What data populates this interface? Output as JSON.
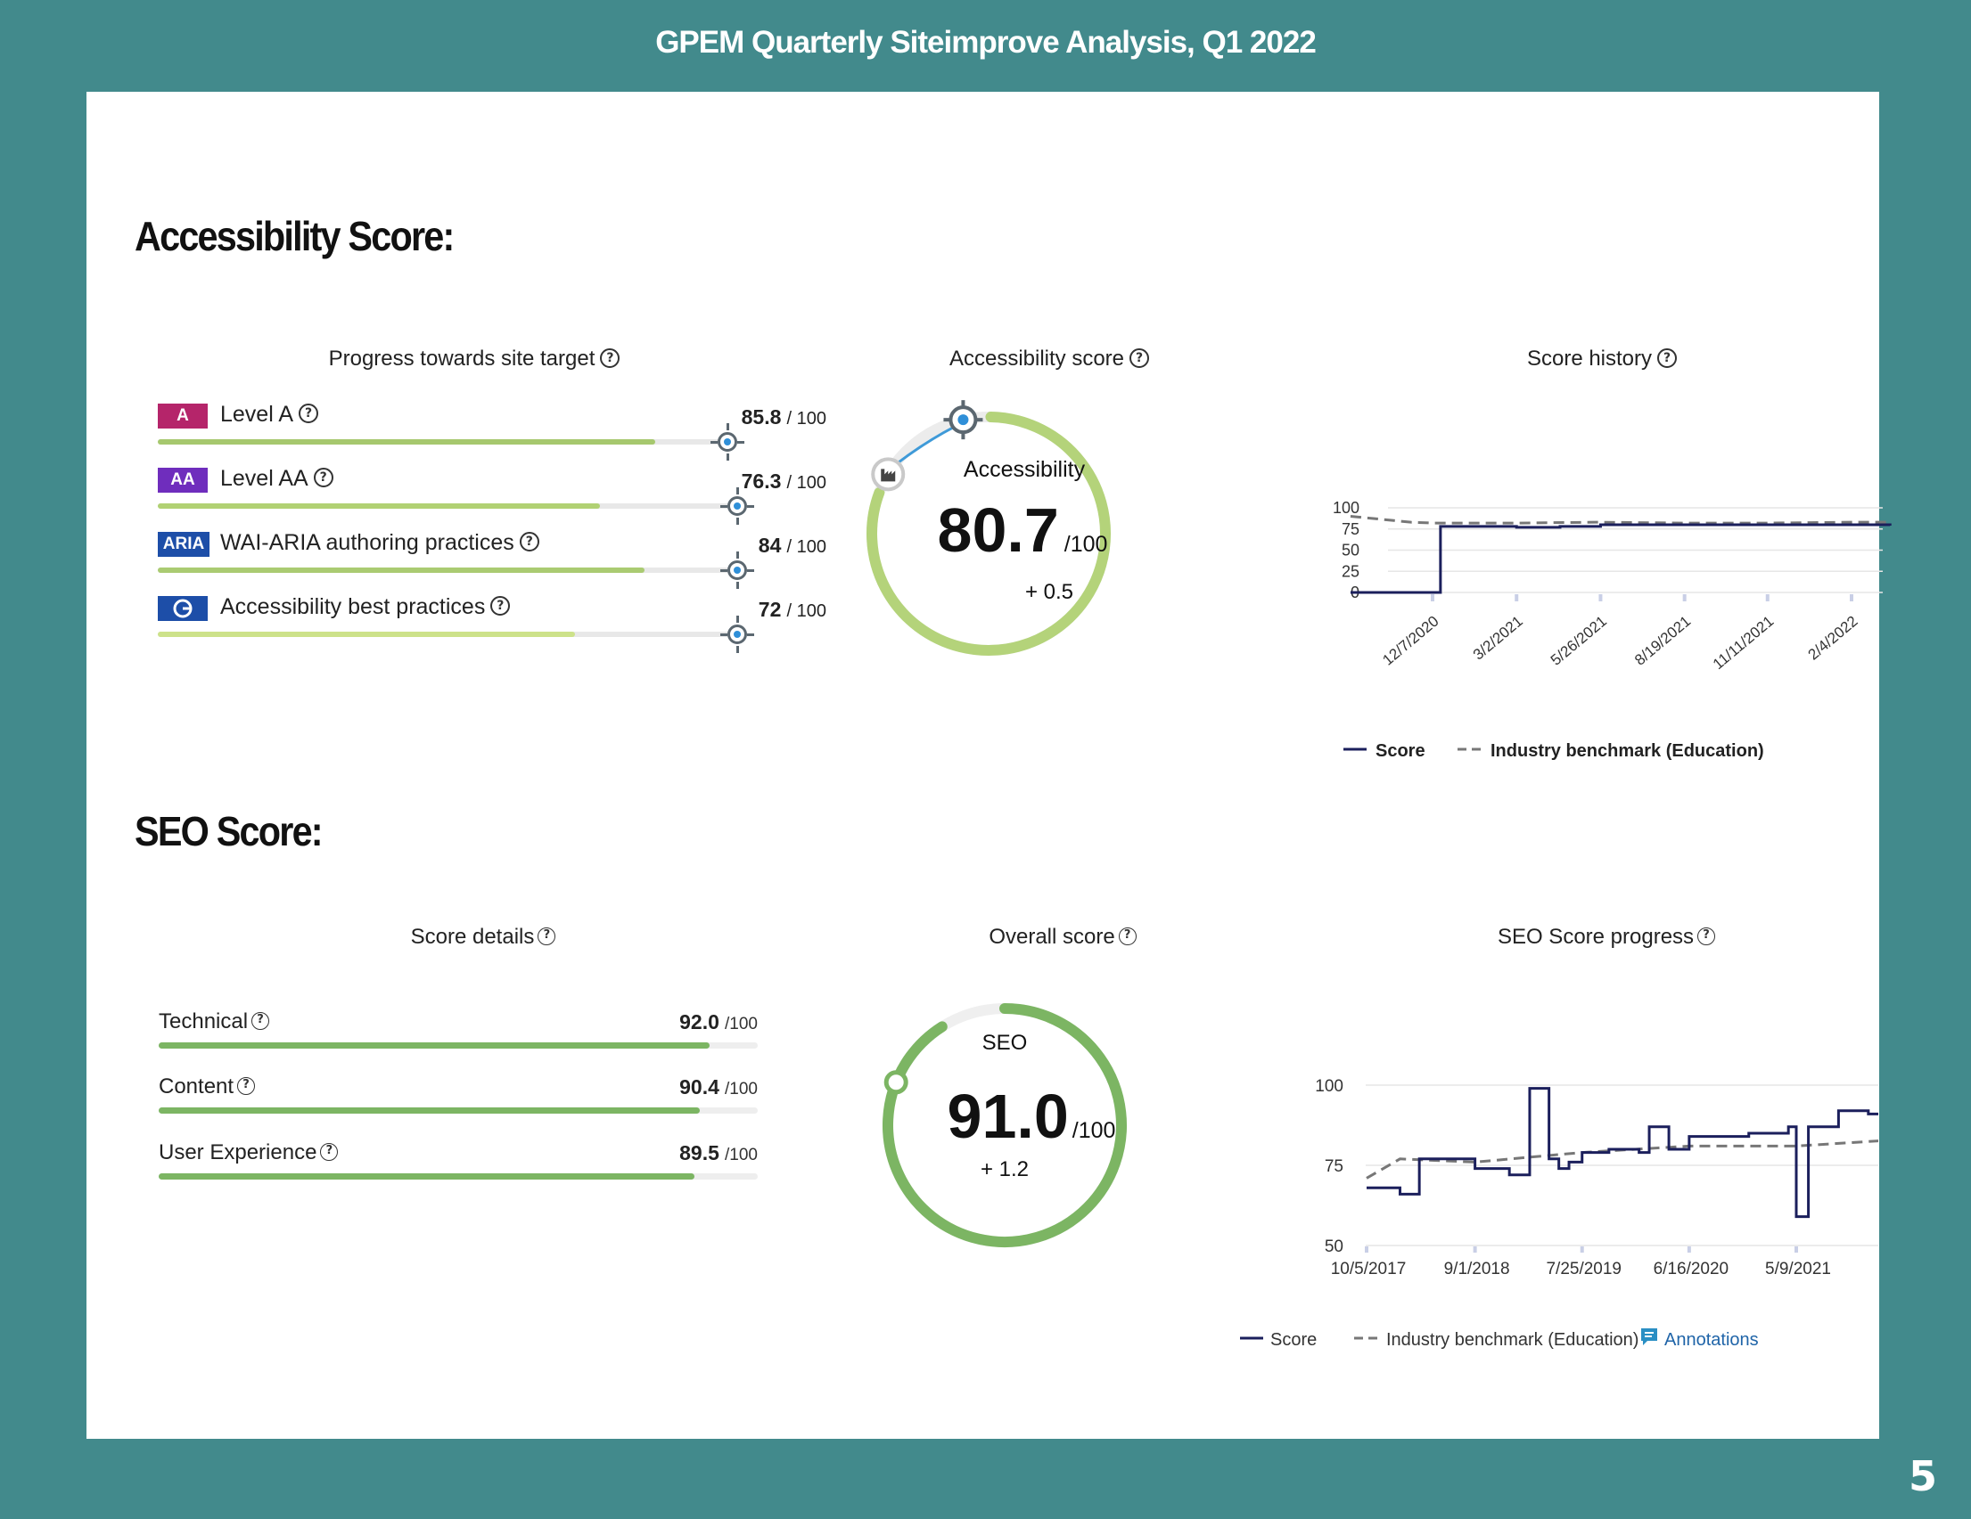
{
  "header": {
    "title": "GPEM Quarterly Siteimprove Analysis, Q1 2022",
    "page_number": "5"
  },
  "accessibility": {
    "section_title": "Accessibility Score:",
    "progress": {
      "title": "Progress towards site target",
      "out_of": "/ 100",
      "items": [
        {
          "badge": "A",
          "badge_color": "#b5256a",
          "label": "Level A",
          "score": "85.8",
          "value": 85.8,
          "target": 100,
          "fill_color": "#a6c86e"
        },
        {
          "badge": "AA",
          "badge_color": "#6f2dbd",
          "label": "Level AA",
          "score": "76.3",
          "value": 76.3,
          "target": 100,
          "fill_color": "#b1d173"
        },
        {
          "badge": "ARIA",
          "badge_color": "#1d4ea8",
          "label": "WAI-ARIA authoring practices",
          "score": "84",
          "value": 84,
          "target": 100,
          "fill_color": "#aacb72"
        },
        {
          "badge": "",
          "badge_icon": "siteimprove-logo-icon",
          "badge_color": "#1d4ea8",
          "label": "Accessibility best practices",
          "score": "72",
          "value": 72,
          "target": 100,
          "fill_color": "#cde28a"
        }
      ]
    },
    "gauge": {
      "title": "Accessibility score",
      "label": "Accessibility",
      "score": "80.7",
      "out_of": "/100",
      "change": "+ 0.5",
      "value": 80.7,
      "benchmark_icon": "industry-benchmark-icon",
      "color": "#b4d37a"
    },
    "history": {
      "title": "Score history",
      "legend_score": "Score",
      "legend_benchmark": "Industry benchmark (Education)"
    }
  },
  "seo": {
    "section_title": "SEO Score:",
    "details": {
      "title": "Score details",
      "out_of": "/100",
      "items": [
        {
          "label": "Technical",
          "score": "92.0",
          "value": 92.0
        },
        {
          "label": "Content",
          "score": "90.4",
          "value": 90.4
        },
        {
          "label": "User Experience",
          "score": "89.5",
          "value": 89.5
        }
      ]
    },
    "gauge": {
      "title": "Overall score",
      "label": "SEO",
      "score": "91.0",
      "out_of": "/100",
      "change": "+ 1.2",
      "value": 91.0,
      "color": "#7cb563"
    },
    "progress": {
      "title": "SEO Score progress",
      "legend_score": "Score",
      "legend_benchmark": "Industry benchmark (Education)",
      "annotations": "Annotations"
    }
  },
  "chart_data": [
    {
      "type": "line",
      "title": "Score history",
      "x_ticks": [
        "12/7/2020",
        "3/2/2021",
        "5/26/2021",
        "8/19/2021",
        "11/11/2021",
        "2/4/2022"
      ],
      "y_ticks": [
        100,
        75,
        50,
        25,
        0
      ],
      "ylim": [
        0,
        100
      ],
      "grid": true,
      "legend": "bottom",
      "series": [
        {
          "name": "Score",
          "style": "solid",
          "color": "#1b1f5c",
          "x": [
            "9/2020",
            "11/2020",
            "12/7/2020",
            "12/15/2020",
            "1/2021",
            "3/2/2021",
            "4/2021",
            "5/26/2021",
            "7/2021",
            "8/19/2021",
            "10/2021",
            "11/11/2021",
            "1/2022",
            "2/4/2022",
            "3/2022"
          ],
          "y": [
            0,
            0,
            0,
            78,
            78,
            77,
            78,
            80,
            80,
            80,
            80,
            80,
            80,
            80,
            79
          ]
        },
        {
          "name": "Industry benchmark (Education)",
          "style": "dashed",
          "color": "#777777",
          "x": [
            "9/2020",
            "11/2020",
            "12/7/2020",
            "1/2021",
            "3/2/2021",
            "5/26/2021",
            "8/19/2021",
            "11/11/2021",
            "2/4/2022",
            "3/2022"
          ],
          "y": [
            90,
            83,
            82,
            82,
            82,
            83,
            82,
            82,
            83,
            83
          ]
        }
      ]
    },
    {
      "type": "line",
      "title": "SEO Score progress",
      "x_ticks": [
        "10/5/2017",
        "9/1/2018",
        "7/25/2019",
        "6/16/2020",
        "5/9/2021"
      ],
      "y_ticks": [
        100,
        75,
        50
      ],
      "ylim": [
        50,
        100
      ],
      "grid": true,
      "legend": "bottom",
      "series": [
        {
          "name": "Score",
          "style": "solid",
          "color": "#1b1f5c",
          "x": [
            "10/5/2017",
            "1/2018",
            "3/2018",
            "5/2018",
            "9/1/2018",
            "12/2018",
            "2/2019",
            "4/2019",
            "5/2019",
            "6/2019",
            "7/25/2019",
            "10/2019",
            "1/2020",
            "2/2020",
            "4/2020",
            "6/16/2020",
            "9/2020",
            "12/2020",
            "4/2021",
            "5/9/2021",
            "6/2021",
            "9/2021",
            "12/2021",
            "3/2022"
          ],
          "y": [
            68,
            66,
            77,
            77,
            74,
            72,
            99,
            77,
            74,
            76,
            79,
            80,
            79,
            87,
            80,
            84,
            84,
            85,
            87,
            59,
            87,
            92,
            91,
            91
          ]
        },
        {
          "name": "Industry benchmark (Education)",
          "style": "dashed",
          "color": "#777777",
          "x": [
            "10/5/2017",
            "1/2018",
            "9/1/2018",
            "7/25/2019",
            "6/16/2020",
            "5/9/2021",
            "3/2022"
          ],
          "y": [
            71,
            77,
            76,
            79,
            81,
            81,
            83
          ]
        }
      ]
    }
  ]
}
